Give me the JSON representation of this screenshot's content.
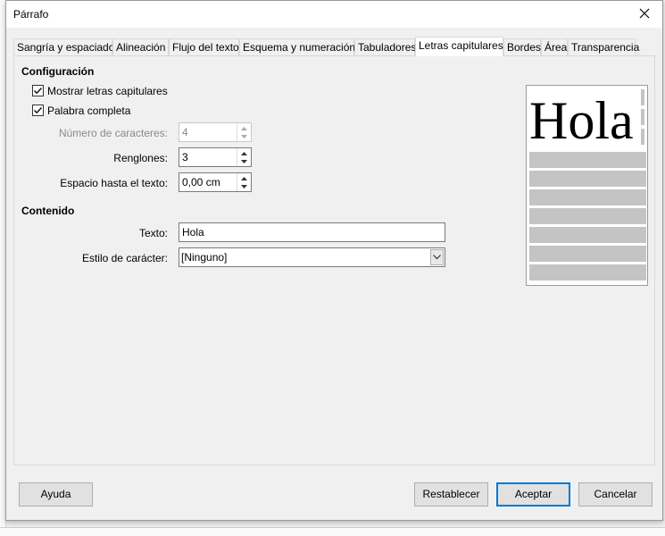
{
  "window": {
    "title": "Párrafo"
  },
  "tabs": [
    {
      "label": "Sangría y espaciado"
    },
    {
      "label": "Alineación"
    },
    {
      "label": "Flujo del texto"
    },
    {
      "label": "Esquema y numeración"
    },
    {
      "label": "Tabuladores"
    },
    {
      "label": "Letras capitulares",
      "active": true
    },
    {
      "label": "Bordes"
    },
    {
      "label": "Área"
    },
    {
      "label": "Transparencia"
    }
  ],
  "config": {
    "heading": "Configuración",
    "show_dropcaps": {
      "label": "Mostrar letras capitulares",
      "checked": true
    },
    "whole_word": {
      "label": "Palabra completa",
      "checked": true
    },
    "num_chars": {
      "label": "Número de caracteres:",
      "value": "4",
      "disabled": true
    },
    "lines": {
      "label": "Renglones:",
      "value": "3"
    },
    "spacing": {
      "label": "Espacio hasta el texto:",
      "value": "0,00 cm"
    }
  },
  "contents": {
    "heading": "Contenido",
    "text": {
      "label": "Texto:",
      "value": "Hola"
    },
    "char_style": {
      "label": "Estilo de carácter:",
      "value": "[Ninguno]"
    }
  },
  "preview": {
    "dropcap_text": "Hola"
  },
  "buttons": {
    "help": "Ayuda",
    "reset": "Restablecer",
    "ok": "Aceptar",
    "cancel": "Cancelar"
  }
}
